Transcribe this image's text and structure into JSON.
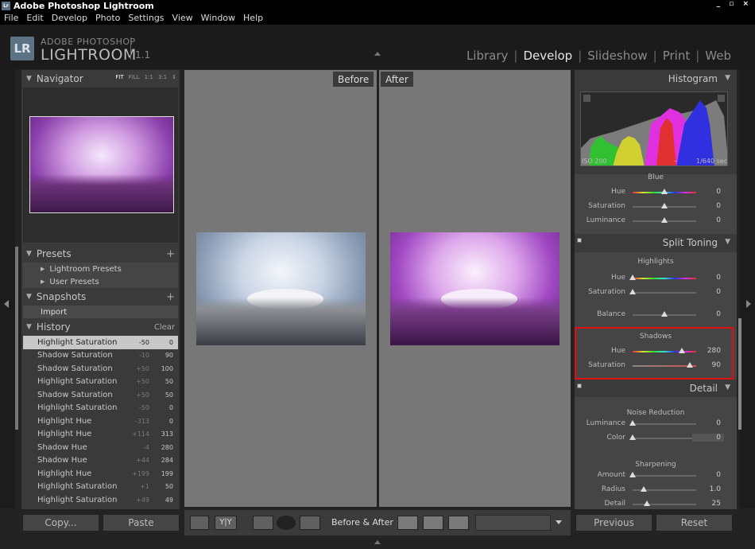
{
  "titlebar": {
    "title": "Adobe Photoshop Lightroom",
    "icon_label": "Lr",
    "window_buttons": "_ ▫ ×"
  },
  "menubar": [
    "File",
    "Edit",
    "Develop",
    "Photo",
    "Settings",
    "View",
    "Window",
    "Help"
  ],
  "identity": {
    "logo_box": "LR",
    "logo_top": "ADOBE PHOTOSHOP",
    "logo_main": "LIGHTROOM",
    "version": "1.1"
  },
  "modules": [
    {
      "label": "Library",
      "active": false
    },
    {
      "label": "Develop",
      "active": true
    },
    {
      "label": "Slideshow",
      "active": false
    },
    {
      "label": "Print",
      "active": false
    },
    {
      "label": "Web",
      "active": false
    }
  ],
  "navigator": {
    "title": "Navigator",
    "zoom": [
      "FIT",
      "FILL",
      "1:1",
      "3:1"
    ],
    "zoom_active": "FIT",
    "zoom_drop": "⇕"
  },
  "presets": {
    "title": "Presets",
    "add": "+",
    "items": [
      "Lightroom Presets",
      "User Presets"
    ]
  },
  "snapshots": {
    "title": "Snapshots",
    "add": "+",
    "import_label": "Import"
  },
  "history": {
    "title": "History",
    "clear": "Clear",
    "rows": [
      {
        "name": "Highlight Saturation",
        "v1": "-50",
        "v2": "0",
        "selected": true
      },
      {
        "name": "Shadow Saturation",
        "v1": "-10",
        "v2": "90",
        "selected": false
      },
      {
        "name": "Shadow Saturation",
        "v1": "+50",
        "v2": "100",
        "selected": false
      },
      {
        "name": "Highlight Saturation",
        "v1": "+50",
        "v2": "50",
        "selected": false
      },
      {
        "name": "Shadow Saturation",
        "v1": "+50",
        "v2": "50",
        "selected": false
      },
      {
        "name": "Highlight Saturation",
        "v1": "-50",
        "v2": "0",
        "selected": false
      },
      {
        "name": "Highlight Hue",
        "v1": "-313",
        "v2": "0",
        "selected": false
      },
      {
        "name": "Highlight Hue",
        "v1": "+114",
        "v2": "313",
        "selected": false
      },
      {
        "name": "Shadow Hue",
        "v1": "-4",
        "v2": "280",
        "selected": false
      },
      {
        "name": "Shadow Hue",
        "v1": "+44",
        "v2": "284",
        "selected": false
      },
      {
        "name": "Highlight Hue",
        "v1": "+199",
        "v2": "199",
        "selected": false
      },
      {
        "name": "Highlight Saturation",
        "v1": "+1",
        "v2": "50",
        "selected": false
      },
      {
        "name": "Highlight Saturation",
        "v1": "+49",
        "v2": "49",
        "selected": false
      }
    ]
  },
  "left_buttons": {
    "copy": "Copy...",
    "paste": "Paste"
  },
  "compare": {
    "before": "Before",
    "after": "After"
  },
  "toolbar": {
    "before_after_label": "Before & After :",
    "yy_label": "Y|Y"
  },
  "histogram": {
    "title": "Histogram",
    "iso": "ISO 200",
    "dash1": "–",
    "dash2": "–",
    "shutter": "1/640 sec"
  },
  "blue_section": {
    "label": "Blue",
    "rows": [
      {
        "label": "Hue",
        "value": "0",
        "pos": 0.5,
        "type": "hue"
      },
      {
        "label": "Saturation",
        "value": "0",
        "pos": 0.5,
        "type": "plain"
      },
      {
        "label": "Luminance",
        "value": "0",
        "pos": 0.5,
        "type": "plain"
      }
    ]
  },
  "split_toning": {
    "title": "Split Toning",
    "highlights_label": "Highlights",
    "highlights": [
      {
        "label": "Hue",
        "value": "0",
        "pos": 0.0,
        "type": "hue"
      },
      {
        "label": "Saturation",
        "value": "0",
        "pos": 0.0,
        "type": "plain"
      }
    ],
    "balance": {
      "label": "Balance",
      "value": "0",
      "pos": 0.5,
      "type": "plain"
    },
    "shadows_label": "Shadows",
    "shadows": [
      {
        "label": "Hue",
        "value": "280",
        "pos": 0.78,
        "type": "hue"
      },
      {
        "label": "Saturation",
        "value": "90",
        "pos": 0.9,
        "type": "sat"
      }
    ]
  },
  "detail": {
    "title": "Detail",
    "noise_label": "Noise Reduction",
    "noise": [
      {
        "label": "Luminance",
        "value": "0",
        "pos": 0.0,
        "type": "plain"
      },
      {
        "label": "Color",
        "value": "0",
        "pos": 0.0,
        "type": "plain"
      }
    ],
    "sharpening_label": "Sharpening",
    "sharpening": [
      {
        "label": "Amount",
        "value": "0",
        "pos": 0.0,
        "type": "plain"
      },
      {
        "label": "Radius",
        "value": "1.0",
        "pos": 0.18,
        "type": "plain"
      },
      {
        "label": "Detail",
        "value": "25",
        "pos": 0.22,
        "type": "plain"
      }
    ]
  },
  "right_buttons": {
    "previous": "Previous",
    "reset": "Reset"
  }
}
